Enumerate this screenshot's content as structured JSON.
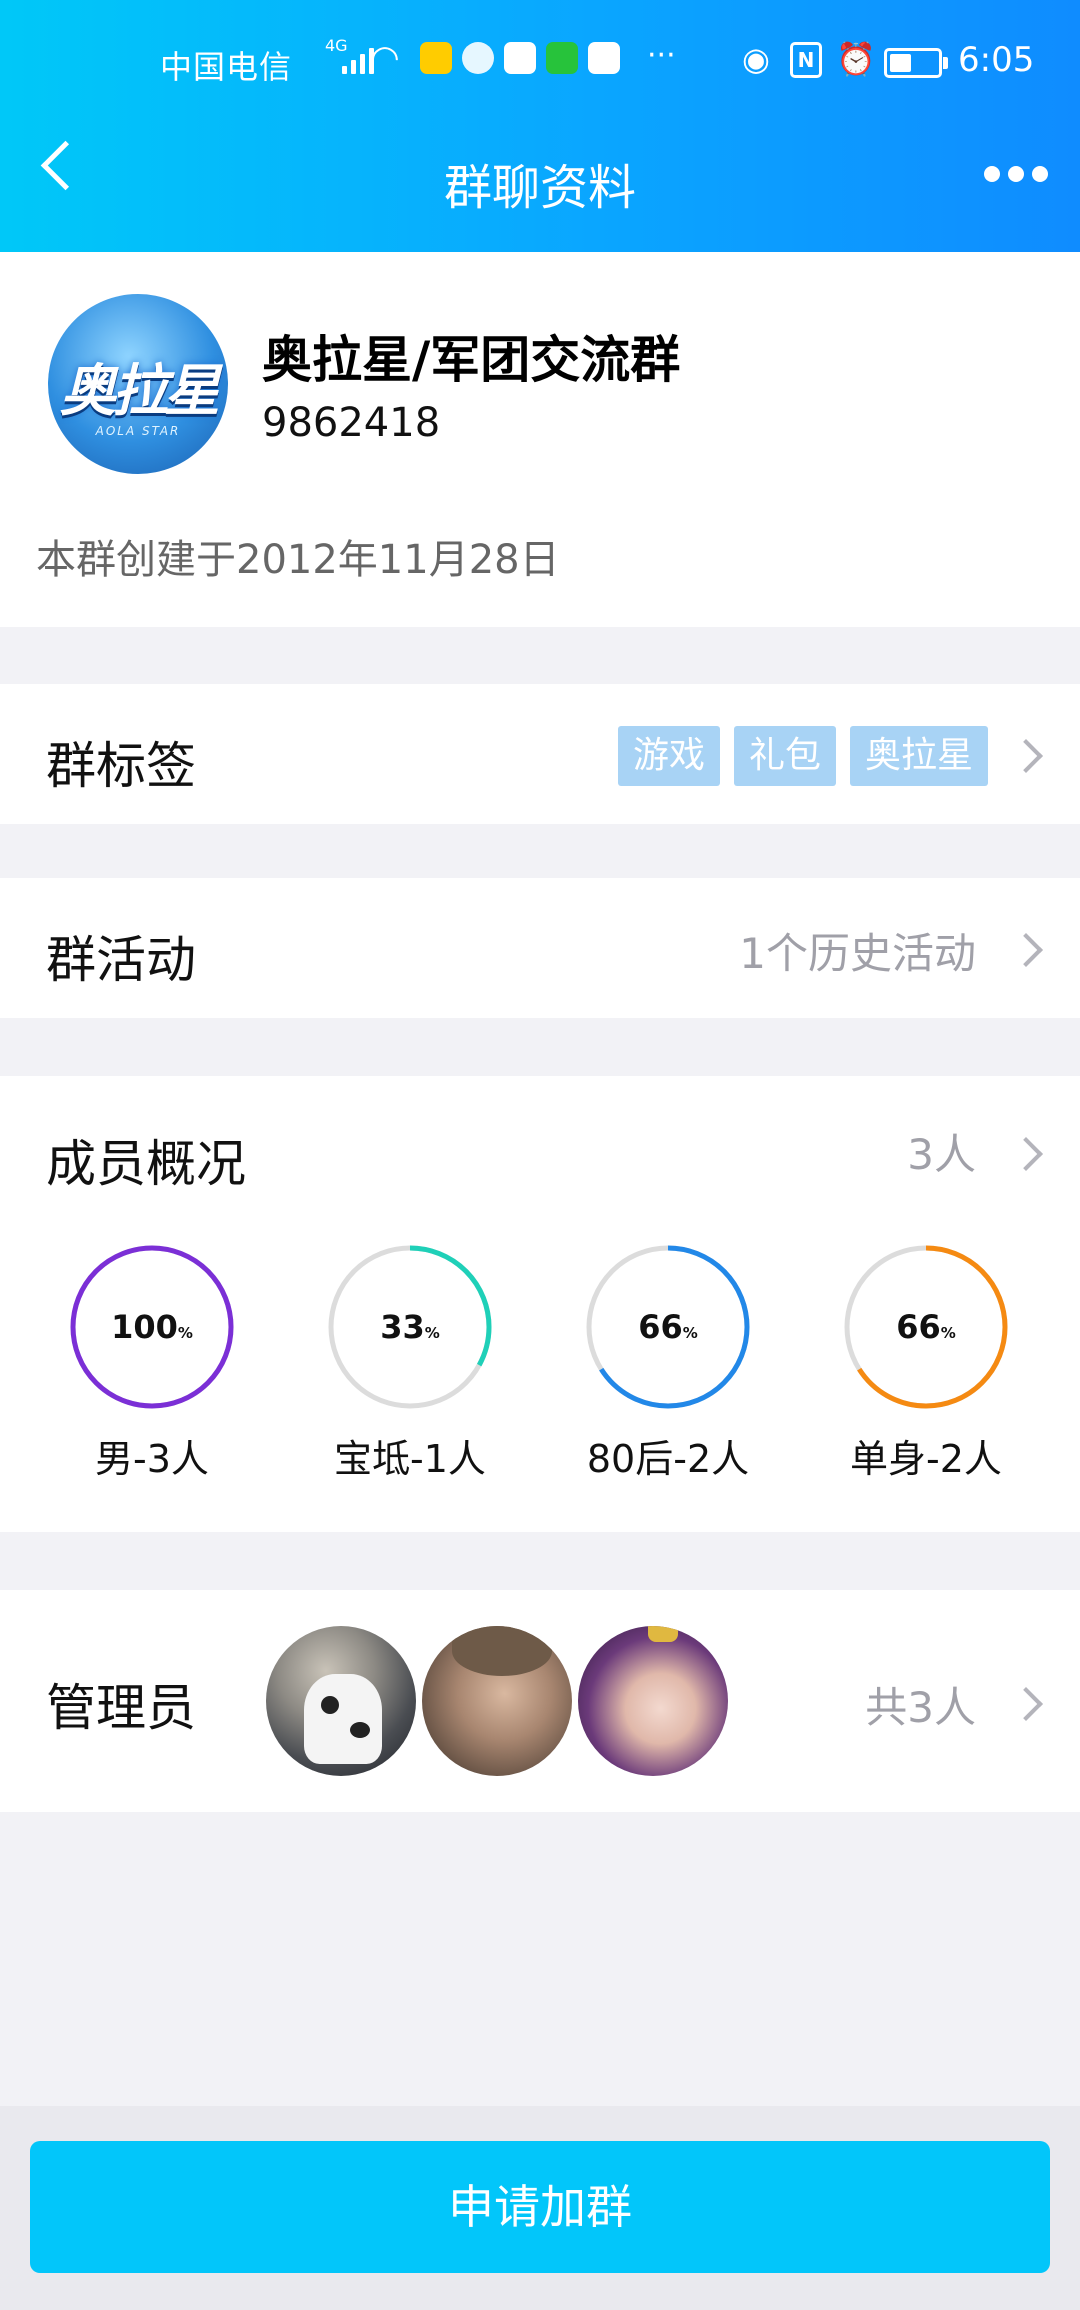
{
  "status_bar": {
    "carrier": "中国电信",
    "network": "4G",
    "time": "6:05",
    "battery_level": 0.45,
    "icons": [
      "signal-icon",
      "wifi-icon",
      "app-icon",
      "chat-icon",
      "cloud-app-icon",
      "iqiyi-icon",
      "weibo-icon",
      "more-dots-icon",
      "eye-icon",
      "nfc-icon",
      "alarm-icon",
      "battery-icon"
    ],
    "overflow": "···"
  },
  "nav": {
    "title": "群聊资料"
  },
  "group": {
    "name": "奥拉星/军团交流群",
    "id": "9862418",
    "created": "本群创建于2012年11月28日",
    "logo_text": "奥拉星",
    "logo_sub": "AOLA STAR"
  },
  "tags_row": {
    "label": "群标签",
    "tags": [
      "游戏",
      "礼包",
      "奥拉星"
    ],
    "tag_color": "#a8d3f5"
  },
  "activity_row": {
    "label": "群活动",
    "value": "1个历史活动"
  },
  "members_row": {
    "label": "成员概况",
    "value": "3人",
    "stats": [
      {
        "pct": "100",
        "pct_value": 1.0,
        "unit": "%",
        "label": "男-3人",
        "color": "#7b2fd6"
      },
      {
        "pct": "33",
        "pct_value": 0.33,
        "unit": "%",
        "label": "宝坻-1人",
        "color": "#1fd0b8"
      },
      {
        "pct": "66",
        "pct_value": 0.66,
        "unit": "%",
        "label": "80后-2人",
        "color": "#2288e8"
      },
      {
        "pct": "66",
        "pct_value": 0.66,
        "unit": "%",
        "label": "单身-2人",
        "color": "#f58a12"
      }
    ]
  },
  "admin_row": {
    "label": "管理员",
    "value": "共3人"
  },
  "join_button": {
    "label": "申请加群",
    "color": "#02c6fa"
  }
}
